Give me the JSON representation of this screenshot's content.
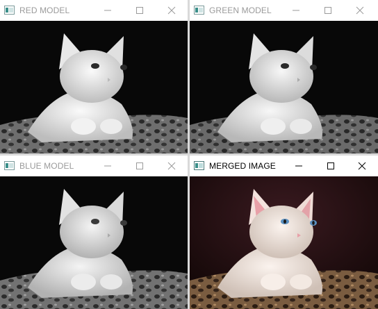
{
  "windows": [
    {
      "id": "red",
      "title": "RED MODEL",
      "active": false,
      "tint": "gray"
    },
    {
      "id": "green",
      "title": "GREEN MODEL",
      "active": false,
      "tint": "gray"
    },
    {
      "id": "blue",
      "title": "BLUE MODEL",
      "active": false,
      "tint": "gray"
    },
    {
      "id": "merged",
      "title": "MERGED IMAGE",
      "active": true,
      "tint": "color"
    }
  ],
  "image_subject": "white kitten on leopard print cushion",
  "colors": {
    "inactive_title": "#9a9a9a",
    "active_title": "#000000",
    "icon_teal": "#3a8f8a",
    "pink_nose": "#e8a0a8",
    "blue_eyes": "#5a8fc0",
    "merged_bg": "#2a1418"
  }
}
